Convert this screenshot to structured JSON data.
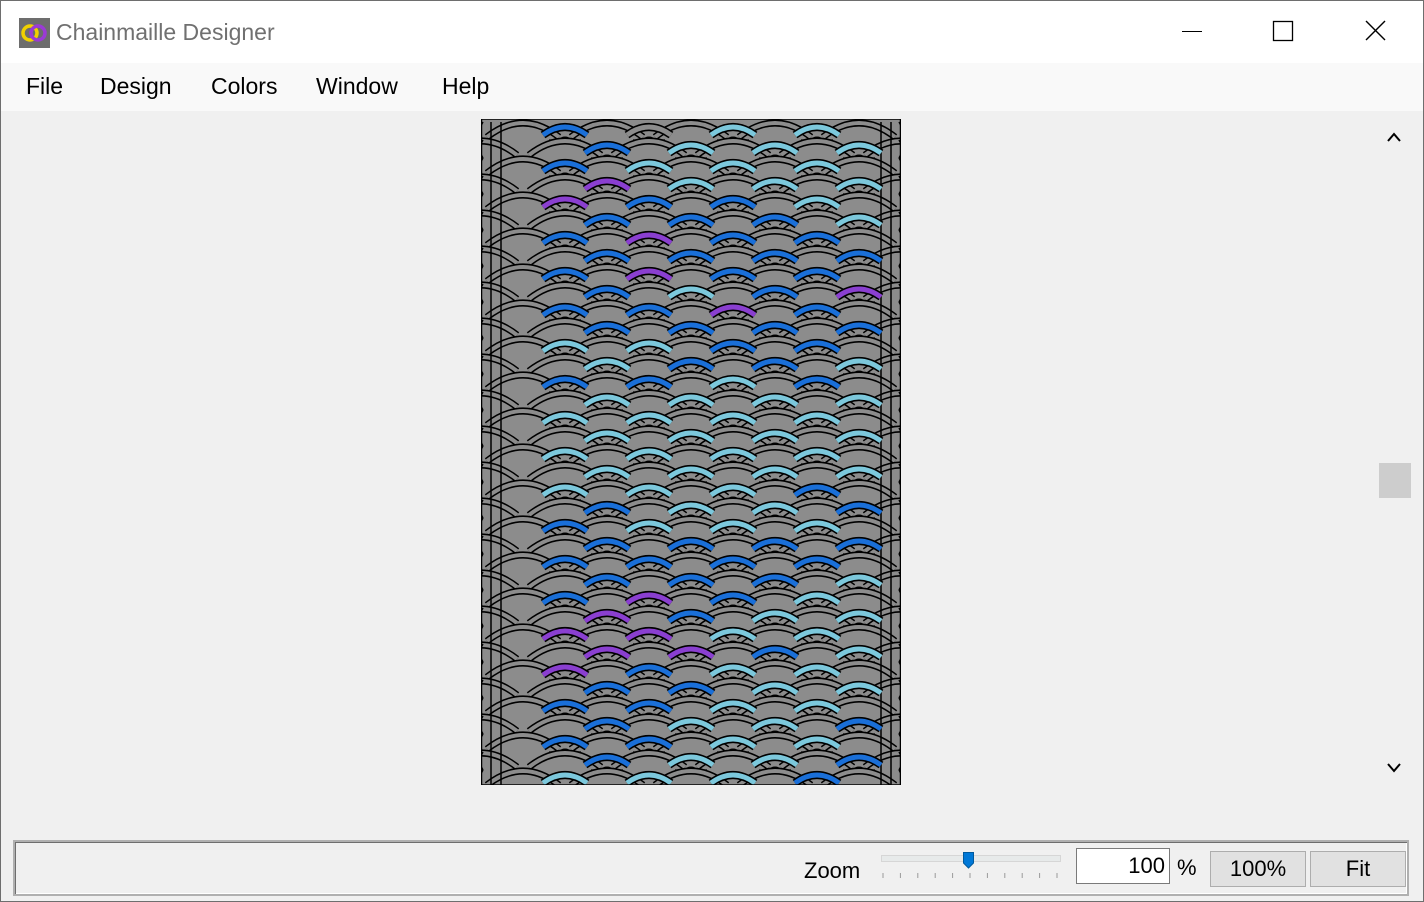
{
  "window": {
    "title": "Chainmaille Designer",
    "icon": "chainmaille-rings-icon"
  },
  "menu": {
    "items": [
      "File",
      "Design",
      "Colors",
      "Window",
      "Help"
    ]
  },
  "design": {
    "colors": {
      "base": "#8c8c8c",
      "outline": "#000000",
      "dark_blue": "#1a6fd8",
      "light_blue": "#7cc8dc",
      "purple": "#8a3fd0"
    },
    "rows": [
      "DBLL",
      "DLLL",
      "DLLL",
      "PLLL",
      "PDDL",
      "DDDL",
      "DPDD",
      "DDDD",
      "DPDD",
      "DLDP",
      "DDPD",
      "DDDD",
      "LLDD",
      "LDDL",
      "DDLD",
      "LLLL",
      "LLLL",
      "LLLL",
      "LLLL",
      "LLLL",
      "LLLD",
      "DLLD",
      "DLLL",
      "DDDD",
      "DDDD",
      "DDDL",
      "DPDL",
      "PDLL",
      "PPLL",
      "PPDL",
      "PDLL",
      "DDLL",
      "DDLL",
      "DLLD",
      "DDLL",
      "DLLD",
      "LLLD"
    ]
  },
  "statusbar": {
    "zoom_label": "Zoom",
    "zoom_value": "100",
    "zoom_slider_fraction": 0.49,
    "percent_sign": "%",
    "button_100": "100%",
    "button_fit": "Fit"
  },
  "scrollbar": {
    "position_fraction": 0.55
  }
}
